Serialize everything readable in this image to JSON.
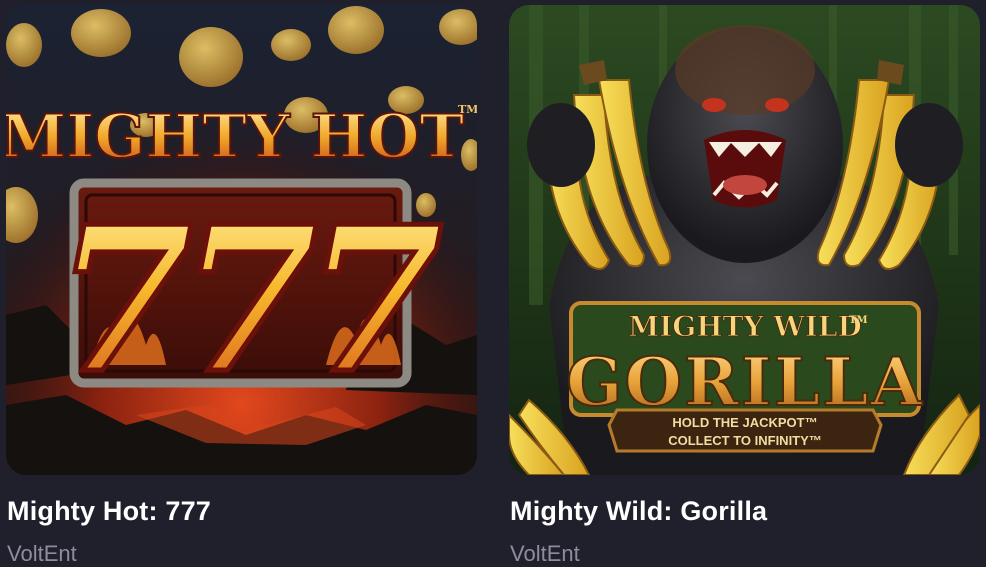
{
  "games": [
    {
      "title": "Mighty Hot: 777",
      "provider": "VoltEnt",
      "art": {
        "logo": "MIGHTY HOT",
        "trademark": "TM",
        "symbol": "777",
        "colors": {
          "sky": "#1a2130",
          "lava": "#c8321a",
          "coin": "#d7a83a",
          "gold": "#f4c23b"
        }
      }
    },
    {
      "title": "Mighty Wild: Gorilla",
      "provider": "VoltEnt",
      "art": {
        "logo_top": "MIGHTY WILD",
        "trademark": "TM",
        "logo_main": "GORILLA",
        "banner_line1": "HOLD THE JACKPOT™",
        "banner_line2": "COLLECT TO INFINITY™",
        "colors": {
          "jungle": "#2f4a22",
          "fur": "#2a2a2e",
          "banana": "#f2cf3a",
          "logo": "#e8a33a"
        }
      }
    }
  ]
}
